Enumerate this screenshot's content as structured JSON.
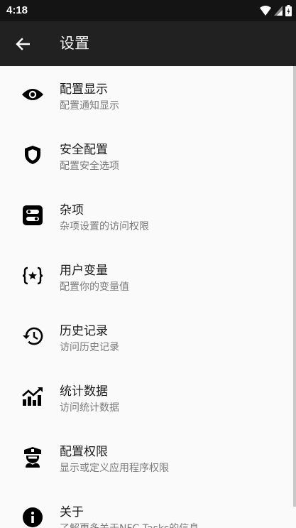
{
  "status": {
    "time": "4:18"
  },
  "app_bar": {
    "title": "设置"
  },
  "items": [
    {
      "title": "配置显示",
      "subtitle": "配置通知显示",
      "icon": "eye-icon"
    },
    {
      "title": "安全配置",
      "subtitle": "配置安全选项",
      "icon": "shield-icon"
    },
    {
      "title": "杂项",
      "subtitle": "杂项设置的访问权限",
      "icon": "toggles-icon"
    },
    {
      "title": "用户变量",
      "subtitle": "配置你的变量值",
      "icon": "variable-icon"
    },
    {
      "title": "历史记录",
      "subtitle": "访问历史记录",
      "icon": "history-icon"
    },
    {
      "title": "统计数据",
      "subtitle": "访问统计数据",
      "icon": "chart-icon"
    },
    {
      "title": "配置权限",
      "subtitle": "显示或定义应用程序权限",
      "icon": "police-icon"
    },
    {
      "title": "关于",
      "subtitle": "了解更多关于NFC Tasks的信息",
      "icon": "info-icon"
    }
  ]
}
